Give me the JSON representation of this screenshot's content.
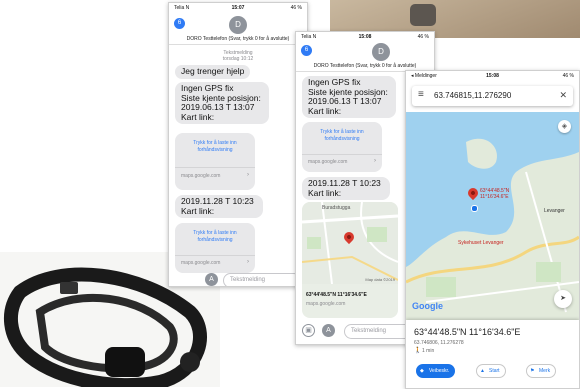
{
  "phone1": {
    "status": {
      "carrier": "Telia N",
      "time": "15:07",
      "battery": "46 %"
    },
    "back_badge": "6",
    "avatar_letter": "D",
    "contact": "DORO Testtelefon (Svar, trykk 0 for å avslutte)",
    "timestamp": {
      "line1": "Tekstmelding",
      "line2": "torsdag 10:12"
    },
    "messages": [
      "Jeg trenger hjelp",
      "Ingen GPS fix\nSiste kjente posisjon:\n2019.06.13 T 13:07\nKart link:",
      "2019.11.28 T 10:23\nKart link:"
    ],
    "link_cards": [
      {
        "text": "Trykk for å laste inn\nforhåndsvisning",
        "domain": "maps.google.com"
      },
      {
        "text": "Trykk for å laste inn\nforhåndsvisning",
        "domain": "maps.google.com"
      }
    ],
    "input_placeholder": "Tekstmelding"
  },
  "phone2": {
    "status": {
      "carrier": "Telia N",
      "time": "15:08",
      "battery": "46 %"
    },
    "back_badge": "6",
    "avatar_letter": "D",
    "contact": "DORO Testtelefon (Svar, trykk 0 for å avslutte)",
    "messages": [
      "Ingen GPS fix\nSiste kjente posisjon:\n2019.06.13 T 13:07\nKart link:",
      "2019.11.28 T 10:23\nKart link:"
    ],
    "link_card": {
      "text": "Trykk for å laste inn\nforhåndsvisning",
      "domain": "maps.google.com"
    },
    "map_place": "Buradstugga",
    "map_data": "Map data ©2019",
    "map_coords": "63°44'48.5\"N 11°16'34.6\"E",
    "map_domain": "maps.google.com",
    "input_placeholder": "Tekstmelding"
  },
  "phone3": {
    "status": {
      "carrier": "◂ Meldinger",
      "time": "15:08",
      "battery": "46 %"
    },
    "search_value": "63.746815,11.276290",
    "pin_label": "63°44'48.5\"N\n11°16'34.6\"E",
    "place_levanger": "Levanger",
    "place_sykehus": "Sykehuset Levanger",
    "google_logo": "Google",
    "result_title": "63°44'48.5\"N 11°16'34.6\"E",
    "result_sub": "63.746806, 11.276278",
    "result_time": "1 min",
    "buttons": {
      "directions": "Veibeskr.",
      "start": "Start",
      "save": "Merk"
    }
  },
  "colors": {
    "ios_blue": "#2f7bf5",
    "bubble_gray": "#e8e8ea",
    "pin_red": "#d83a2e",
    "google_blue": "#1a73e8"
  }
}
